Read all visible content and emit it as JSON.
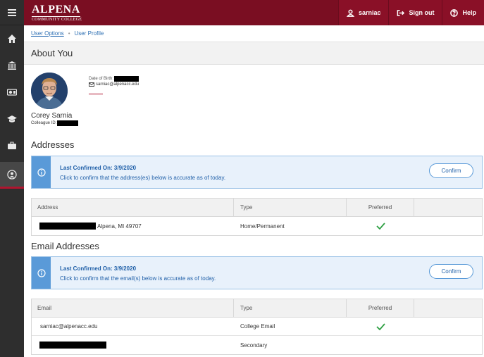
{
  "header": {
    "logo_main": "ALPENA",
    "logo_sub": "COMMUNITY COLLEGE",
    "user_label": "sarniac",
    "signout_label": "Sign out",
    "help_label": "Help"
  },
  "rail": {
    "items": [
      "menu-icon",
      "home-icon",
      "institution-icon",
      "finance-icon",
      "graduation-cap-icon",
      "briefcase-icon",
      "user-profile-icon"
    ],
    "active": "user-profile-icon"
  },
  "breadcrumb": {
    "first": "User Options",
    "second": "User Profile"
  },
  "page": {
    "title": "About You"
  },
  "profile": {
    "name": "Corey Sarnia",
    "id_label": "Colleague ID:",
    "dob_label": "Date of Birth:",
    "email": "sarniac@alpenacc.edu"
  },
  "addresses": {
    "title": "Addresses",
    "confirmed": "Last Confirmed On: 3/9/2020",
    "instruction": "Click to confirm that the address(es) below is accurate as of today.",
    "confirm_label": "Confirm",
    "columns": [
      "Address",
      "Type",
      "Preferred"
    ],
    "rows": [
      {
        "address_suffix": "Alpena, MI 49707",
        "type": "Home/Permanent",
        "preferred": true
      }
    ]
  },
  "emails": {
    "title": "Email Addresses",
    "confirmed": "Last Confirmed On: 3/9/2020",
    "instruction": "Click to confirm that the email(s) below is accurate as of today.",
    "confirm_label": "Confirm",
    "columns": [
      "Email",
      "Type",
      "Preferred"
    ],
    "rows": [
      {
        "email": "sarniac@alpenacc.edu",
        "type": "College Email",
        "preferred": true
      },
      {
        "email": "",
        "type": "Secondary",
        "preferred": false
      }
    ]
  },
  "colors": {
    "header": "#7a0e22",
    "rail": "#2e2e2e",
    "accent_blue": "#1f5fa8",
    "check_green": "#2ea043"
  }
}
